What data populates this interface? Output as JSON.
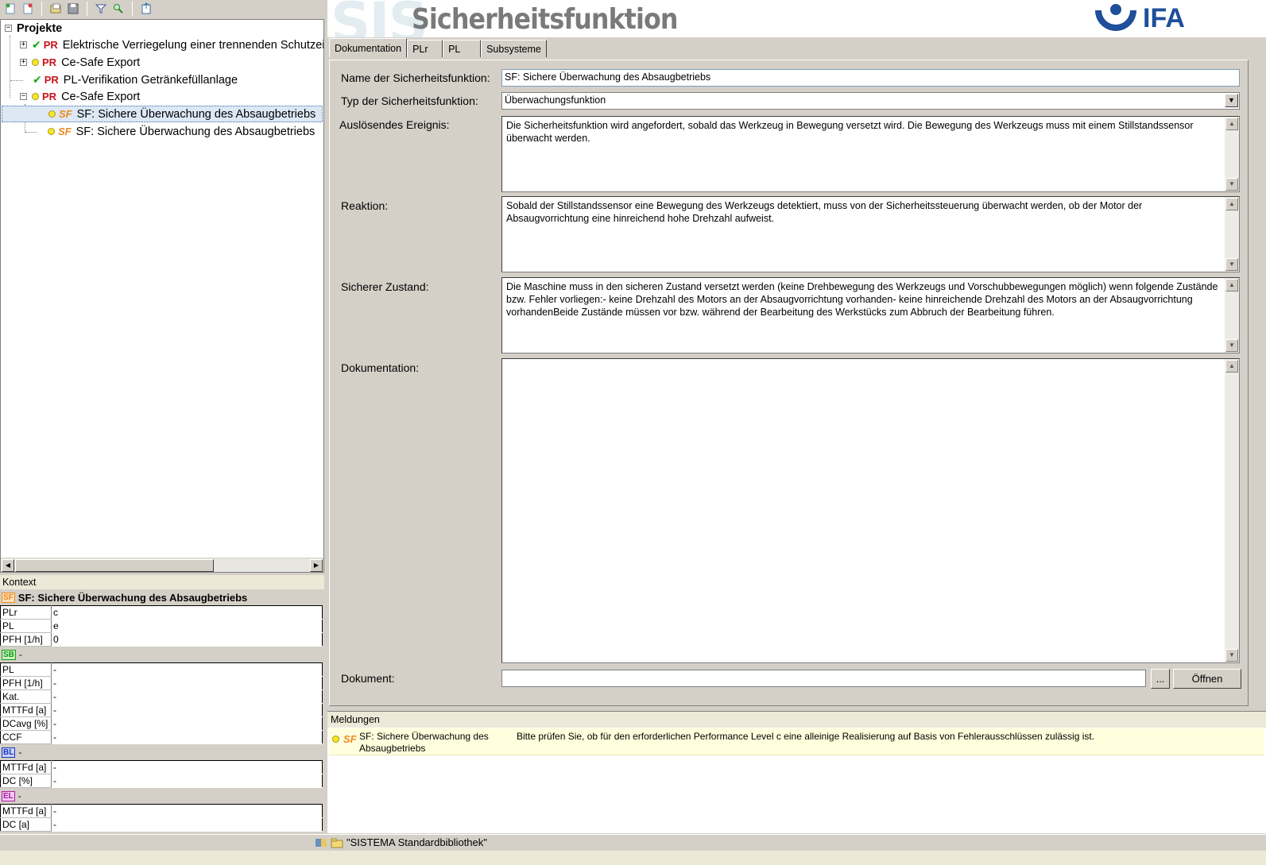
{
  "tree": {
    "root_label": "Projekte",
    "prefix_pr": "PR",
    "prefix_sf": "SF",
    "items": [
      {
        "label": "Elektrische Verriegelung einer trennenden Schutzei"
      },
      {
        "label": "Ce-Safe Export"
      },
      {
        "label": "PL-Verifikation Getränkefüllanlage"
      },
      {
        "label": "Ce-Safe Export"
      },
      {
        "label": "SF: Sichere Überwachung des Absaugbetriebs"
      },
      {
        "label": "SF: Sichere Überwachung des Absaugbetriebs"
      }
    ]
  },
  "context": {
    "header": "Kontext",
    "title": "SF: Sichere Überwachung des Absaugbetriebs",
    "badge_sf": "SF",
    "sf_rows": [
      {
        "k": "PLr",
        "v": "c"
      },
      {
        "k": "PL",
        "v": "e"
      },
      {
        "k": "PFH [1/h]",
        "v": "0"
      }
    ],
    "badge_sb": "SB",
    "sb_value": "-",
    "sb_rows": [
      {
        "k": "PL",
        "v": "-"
      },
      {
        "k": "PFH [1/h]",
        "v": "-"
      },
      {
        "k": "Kat.",
        "v": "-"
      },
      {
        "k": "MTTFd [a]",
        "v": "-"
      },
      {
        "k": "DCavg [%]",
        "v": "-"
      },
      {
        "k": "CCF",
        "v": "-"
      }
    ],
    "badge_bl": "BL",
    "bl_value": "-",
    "bl_rows": [
      {
        "k": "MTTFd [a]",
        "v": "-"
      },
      {
        "k": "DC [%]",
        "v": "-"
      }
    ],
    "badge_el": "EL",
    "el_value": "-",
    "el_rows": [
      {
        "k": "MTTFd [a]",
        "v": "-"
      },
      {
        "k": "DC [a]",
        "v": "-"
      }
    ]
  },
  "banner": {
    "watermark": "SIS",
    "title": "Sicherheitsfunktion",
    "logo_text": "IFA"
  },
  "tabs": [
    {
      "label": "Dokumentation"
    },
    {
      "label": "PLr"
    },
    {
      "label": "PL"
    },
    {
      "label": "Subsysteme"
    }
  ],
  "form": {
    "name_label": "Name der Sicherheitsfunktion:",
    "name_value": "SF: Sichere Überwachung des Absaugbetriebs",
    "type_label": "Typ der Sicherheitsfunktion:",
    "type_value": "Überwachungsfunktion",
    "trigger_label": "Auslösendes Ereignis:",
    "trigger_value": "Die Sicherheitsfunktion wird angefordert, sobald das Werkzeug in Bewegung versetzt wird. Die Bewegung des Werkzeugs muss mit einem Stillstandssensor überwacht werden.",
    "reaction_label": "Reaktion:",
    "reaction_value": "Sobald der Stillstandssensor eine Bewegung des Werkzeugs detektiert, muss von der Sicherheitssteuerung überwacht werden, ob der Motor der Absaugvorrichtung eine hinreichend hohe Drehzahl aufweist.",
    "safe_state_label": "Sicherer Zustand:",
    "safe_state_value": "Die Maschine muss in den sicheren Zustand versetzt werden (keine Drehbewegung des Werkzeugs und Vorschubbewegungen möglich) wenn folgende Zustände bzw. Fehler vorliegen:- keine Drehzahl des Motors an der Absaugvorrichtung vorhanden- keine hinreichende Drehzahl des Motors an der Absaugvorrichtung vorhandenBeide Zustände müssen vor bzw. während der Bearbeitung des Werkstücks zum Abbruch der Bearbeitung führen.",
    "doc_label": "Dokumentation:",
    "doc_value": "",
    "document_label": "Dokument:",
    "document_value": "",
    "browse_label": "...",
    "open_label": "Öffnen"
  },
  "messages": {
    "header": "Meldungen",
    "prefix": "SF",
    "items": [
      {
        "source": "SF: Sichere Überwachung des Absaugbetriebs",
        "text": "Bitte prüfen Sie, ob für den erforderlichen Performance Level c eine alleinige Realisierung auf Basis von Fehlerausschlüssen zulässig ist."
      }
    ]
  },
  "status": {
    "library": "\"SISTEMA Standardbibliothek\""
  },
  "colors": {
    "pr": "#c8141e",
    "sf": "#ef8a1e",
    "check": "#15a815",
    "ifa_blue": "#1f4e9a",
    "selection": "#dde8f5",
    "message_bg": "#ffffdd"
  }
}
